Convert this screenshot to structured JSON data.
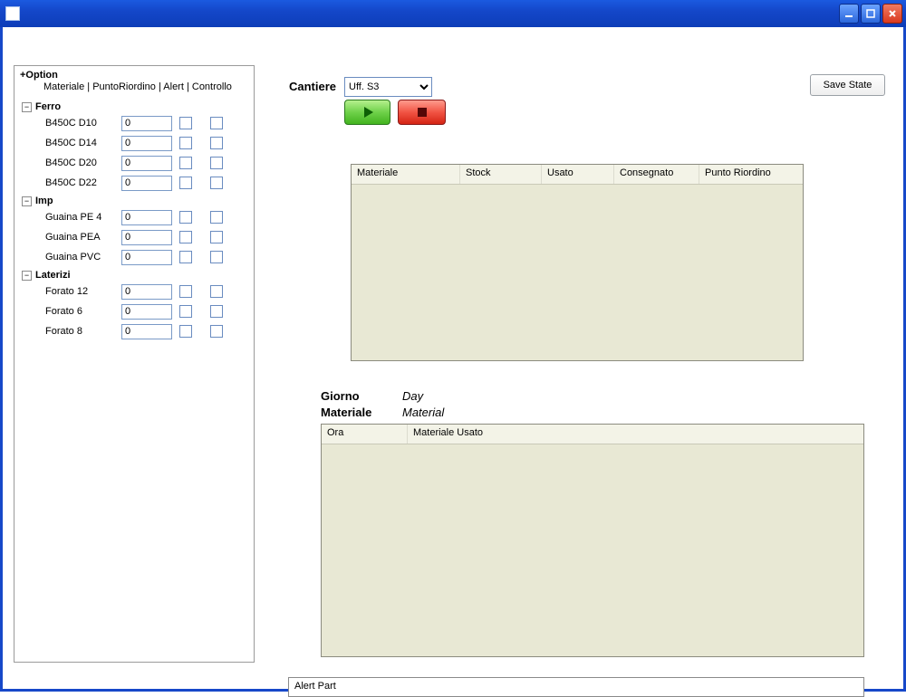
{
  "option": {
    "title": "+Option",
    "tabs": "Materiale | PuntoRiordino | Alert | Controllo"
  },
  "categories": [
    {
      "name": "Ferro",
      "items": [
        {
          "label": "B450C D10",
          "value": "0"
        },
        {
          "label": "B450C D14",
          "value": "0"
        },
        {
          "label": "B450C D20",
          "value": "0"
        },
        {
          "label": "B450C D22",
          "value": "0"
        }
      ]
    },
    {
      "name": "Imp",
      "items": [
        {
          "label": "Guaina PE 4",
          "value": "0"
        },
        {
          "label": "Guaina PEA",
          "value": "0"
        },
        {
          "label": "Guaina PVC",
          "value": "0"
        }
      ]
    },
    {
      "name": "Laterizi",
      "items": [
        {
          "label": "Forato 12",
          "value": "0"
        },
        {
          "label": "Forato 6",
          "value": "0"
        },
        {
          "label": "Forato 8",
          "value": "0"
        }
      ]
    }
  ],
  "cantiere": {
    "label": "Cantiere",
    "selected": "Uff. S3"
  },
  "save_label": "Save State",
  "grid1": {
    "headers": [
      "Materiale",
      "Stock",
      "Usato",
      "Consegnato",
      "Punto Riordino"
    ]
  },
  "info": {
    "giorno_label": "Giorno",
    "giorno_value": "Day",
    "materiale_label": "Materiale",
    "materiale_value": "Material"
  },
  "grid2": {
    "headers": [
      "Ora",
      "Materiale Usato"
    ]
  },
  "alert": "Alert Part"
}
